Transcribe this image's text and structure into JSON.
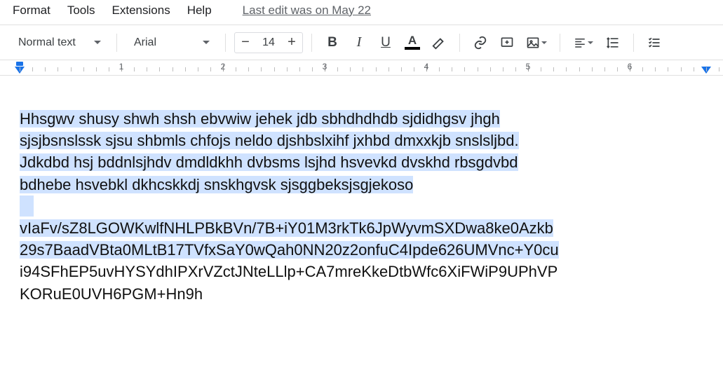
{
  "menubar": {
    "items": [
      "Format",
      "Tools",
      "Extensions",
      "Help"
    ],
    "last_edit": "Last edit was on May 22"
  },
  "toolbar": {
    "style_dropdown": "Normal text",
    "font_dropdown": "Arial",
    "font_size": "14",
    "minus": "−",
    "plus": "+",
    "textcolor_letter": "A"
  },
  "document": {
    "para1_lines": [
      "Hhsgwv shusy shwh shsh ebvwiw jehek jdb sbhdhdhdb sjdidhgsv jhgh ",
      "sjsjbsnslssk sjsu shbmls chfojs neldo djshbslxihf jxhbd dmxxkjb snslsljbd. ",
      "Jdkdbd hsj bddnlsjhdv dmdldkhh dvbsms lsjhd hsvevkd dvskhd rbsgdvbd ",
      "bdhebe hsvebkl dkhcskkdj snskhgvsk sjsggbeksjsgjekoso "
    ],
    "para2_sel_lines": [
      "vIaFv/sZ8LGOWKwlfNHLPBkBVn/7B+iY01M3rkTk6JpWyvmSXDwa8ke0Azkb",
      "29s7BaadVBta0MLtB17TVfxSaY0wQah0NN20z2onfuC4Ipde626UMVnc+Y0cu"
    ],
    "para2_plain_lines": [
      "i94SFhEP5uvHYSYdhIPXrVZctJNteLLlp+CA7mreKkeDtbWfc6XiFWiP9UPhVP",
      "KORuE0UVH6PGM+Hn9h"
    ]
  },
  "ruler": {
    "numbers": [
      1,
      2,
      3,
      4,
      5,
      6
    ]
  }
}
